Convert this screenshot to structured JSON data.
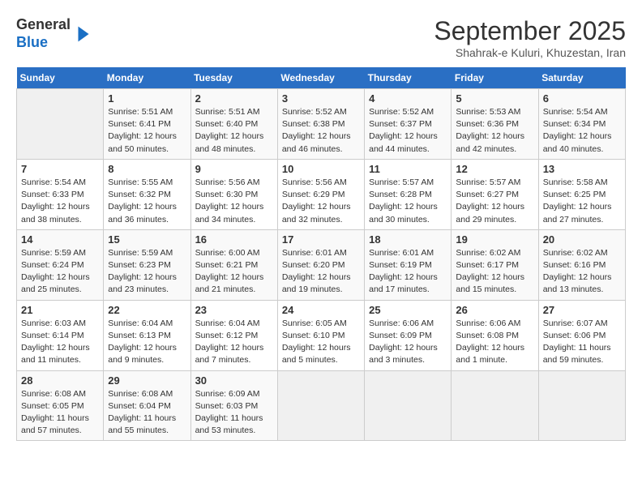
{
  "header": {
    "logo_line1": "General",
    "logo_line2": "Blue",
    "month": "September 2025",
    "location": "Shahrak-e Kuluri, Khuzestan, Iran"
  },
  "weekdays": [
    "Sunday",
    "Monday",
    "Tuesday",
    "Wednesday",
    "Thursday",
    "Friday",
    "Saturday"
  ],
  "weeks": [
    [
      {
        "day": "",
        "info": ""
      },
      {
        "day": "1",
        "info": "Sunrise: 5:51 AM\nSunset: 6:41 PM\nDaylight: 12 hours\nand 50 minutes."
      },
      {
        "day": "2",
        "info": "Sunrise: 5:51 AM\nSunset: 6:40 PM\nDaylight: 12 hours\nand 48 minutes."
      },
      {
        "day": "3",
        "info": "Sunrise: 5:52 AM\nSunset: 6:38 PM\nDaylight: 12 hours\nand 46 minutes."
      },
      {
        "day": "4",
        "info": "Sunrise: 5:52 AM\nSunset: 6:37 PM\nDaylight: 12 hours\nand 44 minutes."
      },
      {
        "day": "5",
        "info": "Sunrise: 5:53 AM\nSunset: 6:36 PM\nDaylight: 12 hours\nand 42 minutes."
      },
      {
        "day": "6",
        "info": "Sunrise: 5:54 AM\nSunset: 6:34 PM\nDaylight: 12 hours\nand 40 minutes."
      }
    ],
    [
      {
        "day": "7",
        "info": "Sunrise: 5:54 AM\nSunset: 6:33 PM\nDaylight: 12 hours\nand 38 minutes."
      },
      {
        "day": "8",
        "info": "Sunrise: 5:55 AM\nSunset: 6:32 PM\nDaylight: 12 hours\nand 36 minutes."
      },
      {
        "day": "9",
        "info": "Sunrise: 5:56 AM\nSunset: 6:30 PM\nDaylight: 12 hours\nand 34 minutes."
      },
      {
        "day": "10",
        "info": "Sunrise: 5:56 AM\nSunset: 6:29 PM\nDaylight: 12 hours\nand 32 minutes."
      },
      {
        "day": "11",
        "info": "Sunrise: 5:57 AM\nSunset: 6:28 PM\nDaylight: 12 hours\nand 30 minutes."
      },
      {
        "day": "12",
        "info": "Sunrise: 5:57 AM\nSunset: 6:27 PM\nDaylight: 12 hours\nand 29 minutes."
      },
      {
        "day": "13",
        "info": "Sunrise: 5:58 AM\nSunset: 6:25 PM\nDaylight: 12 hours\nand 27 minutes."
      }
    ],
    [
      {
        "day": "14",
        "info": "Sunrise: 5:59 AM\nSunset: 6:24 PM\nDaylight: 12 hours\nand 25 minutes."
      },
      {
        "day": "15",
        "info": "Sunrise: 5:59 AM\nSunset: 6:23 PM\nDaylight: 12 hours\nand 23 minutes."
      },
      {
        "day": "16",
        "info": "Sunrise: 6:00 AM\nSunset: 6:21 PM\nDaylight: 12 hours\nand 21 minutes."
      },
      {
        "day": "17",
        "info": "Sunrise: 6:01 AM\nSunset: 6:20 PM\nDaylight: 12 hours\nand 19 minutes."
      },
      {
        "day": "18",
        "info": "Sunrise: 6:01 AM\nSunset: 6:19 PM\nDaylight: 12 hours\nand 17 minutes."
      },
      {
        "day": "19",
        "info": "Sunrise: 6:02 AM\nSunset: 6:17 PM\nDaylight: 12 hours\nand 15 minutes."
      },
      {
        "day": "20",
        "info": "Sunrise: 6:02 AM\nSunset: 6:16 PM\nDaylight: 12 hours\nand 13 minutes."
      }
    ],
    [
      {
        "day": "21",
        "info": "Sunrise: 6:03 AM\nSunset: 6:14 PM\nDaylight: 12 hours\nand 11 minutes."
      },
      {
        "day": "22",
        "info": "Sunrise: 6:04 AM\nSunset: 6:13 PM\nDaylight: 12 hours\nand 9 minutes."
      },
      {
        "day": "23",
        "info": "Sunrise: 6:04 AM\nSunset: 6:12 PM\nDaylight: 12 hours\nand 7 minutes."
      },
      {
        "day": "24",
        "info": "Sunrise: 6:05 AM\nSunset: 6:10 PM\nDaylight: 12 hours\nand 5 minutes."
      },
      {
        "day": "25",
        "info": "Sunrise: 6:06 AM\nSunset: 6:09 PM\nDaylight: 12 hours\nand 3 minutes."
      },
      {
        "day": "26",
        "info": "Sunrise: 6:06 AM\nSunset: 6:08 PM\nDaylight: 12 hours\nand 1 minute."
      },
      {
        "day": "27",
        "info": "Sunrise: 6:07 AM\nSunset: 6:06 PM\nDaylight: 11 hours\nand 59 minutes."
      }
    ],
    [
      {
        "day": "28",
        "info": "Sunrise: 6:08 AM\nSunset: 6:05 PM\nDaylight: 11 hours\nand 57 minutes."
      },
      {
        "day": "29",
        "info": "Sunrise: 6:08 AM\nSunset: 6:04 PM\nDaylight: 11 hours\nand 55 minutes."
      },
      {
        "day": "30",
        "info": "Sunrise: 6:09 AM\nSunset: 6:03 PM\nDaylight: 11 hours\nand 53 minutes."
      },
      {
        "day": "",
        "info": ""
      },
      {
        "day": "",
        "info": ""
      },
      {
        "day": "",
        "info": ""
      },
      {
        "day": "",
        "info": ""
      }
    ]
  ]
}
